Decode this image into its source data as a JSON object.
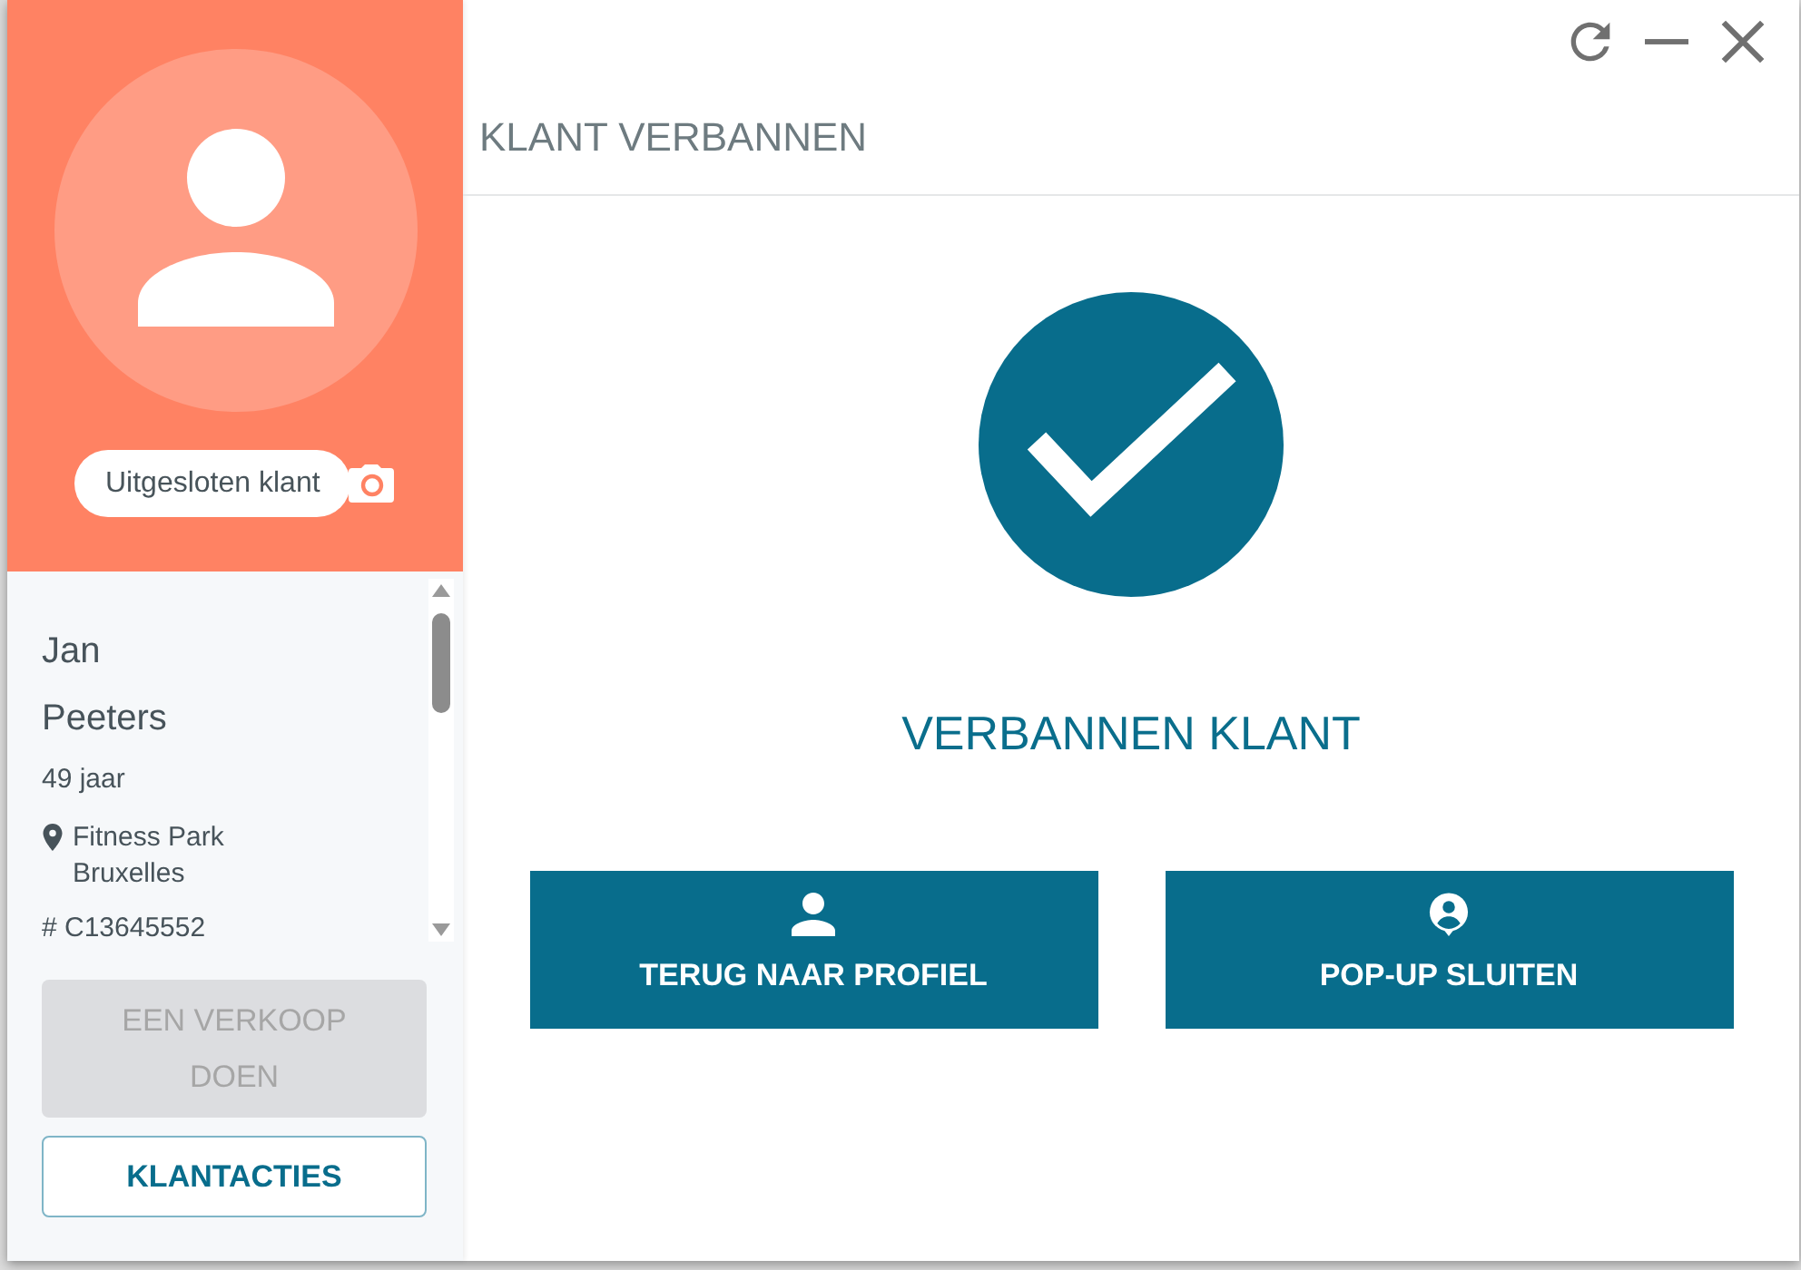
{
  "window": {
    "title": "KLANT VERBANNEN"
  },
  "customer": {
    "status_badge": "Uitgesloten klant",
    "first_name": "Jan",
    "last_name": "Peeters",
    "age": "49 jaar",
    "location": "Fitness Park Bruxelles",
    "customer_number": "# C13645552"
  },
  "panel_buttons": [
    {
      "label": "EEN VERKOOP DOEN",
      "disabled": true
    },
    {
      "label": "KLANTACTIES",
      "disabled": false
    }
  ],
  "result": {
    "message": "VERBANNEN KLANT"
  },
  "actions": [
    {
      "label": "TERUG NAAR PROFIEL",
      "kind": "profile"
    },
    {
      "label": "POP-UP SLUITEN",
      "kind": "close"
    }
  ]
}
